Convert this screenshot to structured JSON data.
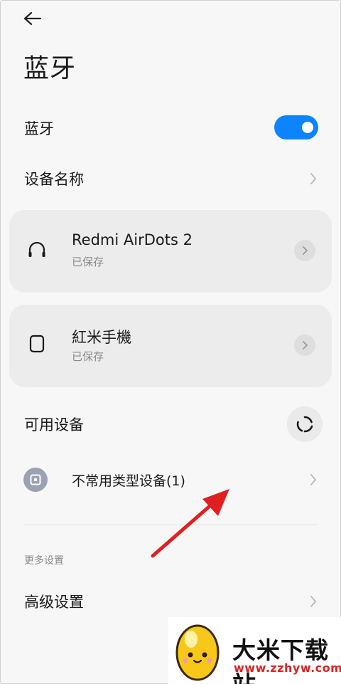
{
  "header": {
    "back_icon": "arrow-left-icon",
    "title": "蓝牙"
  },
  "bluetooth_toggle": {
    "label": "蓝牙",
    "enabled": true,
    "color": "#0d84ff"
  },
  "device_name": {
    "label": "设备名称"
  },
  "saved_devices": [
    {
      "name": "Redmi AirDots 2",
      "status": "已保存",
      "icon": "headphones-icon"
    },
    {
      "name": "紅米手機",
      "status": "已保存",
      "icon": "phone-icon"
    }
  ],
  "available": {
    "label": "可用设备",
    "refresh_icon": "refresh-icon",
    "items": [
      {
        "name": "不常用类型设备(1)",
        "icon": "device-icon"
      }
    ]
  },
  "more": {
    "section_label": "更多设置",
    "advanced_label": "高级设置"
  },
  "watermark": {
    "brand": "大米下载站",
    "url": "www.zzhyw.com"
  }
}
